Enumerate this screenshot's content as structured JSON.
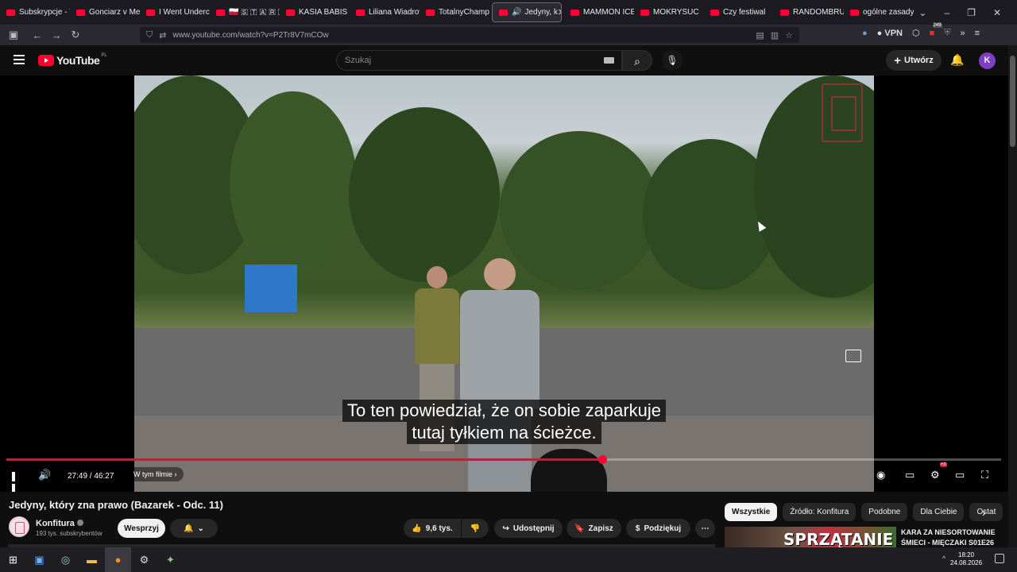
{
  "browser": {
    "tabs": [
      {
        "label": "Subskrypcje - Yo"
      },
      {
        "label": "Gonciarz v Mecir"
      },
      {
        "label": "I Went Undercov"
      },
      {
        "label": "🇵🇱 🇸 🇹 🇦 🇷 🇸"
      },
      {
        "label": "KASIA BABIS SZC"
      },
      {
        "label": "Liliana Wiadrow"
      },
      {
        "label": "TotalnyChampio"
      },
      {
        "label": "Jedyny, k",
        "active": true
      },
      {
        "label": "MAMMON ICEBE"
      },
      {
        "label": "MOKRYSUC"
      },
      {
        "label": "Czy festiwal"
      },
      {
        "label": "RANDOMBRUCE"
      },
      {
        "label": "ogólne zasady w"
      }
    ],
    "url": "www.youtube.com/watch?v=P2Tr8V7mCOw",
    "vpn_label": "VPN",
    "badge_count": "249"
  },
  "youtube": {
    "logo_text": "YouTube",
    "region": "PL",
    "search_placeholder": "Szukaj",
    "create_label": "Utwórz",
    "avatar_letter": "K"
  },
  "player": {
    "subtitle_line1": "To ten powiedział, że on sobie zaparkuje",
    "subtitle_line2": "tutaj tyłkiem na ścieżce.",
    "time": "27:49 / 46:27",
    "progress": 0.599,
    "chapters_label": "W tym filmie",
    "hd_badge": "HD"
  },
  "video": {
    "title": "Jedyny, który zna prawo (Bazarek - Odc. 11)",
    "channel": "Konfitura",
    "subscribers": "193 tys. subskrybentów",
    "support_label": "Wesprzyj",
    "likes": "9,6 tys.",
    "share_label": "Udostępnij",
    "save_label": "Zapisz",
    "thanks_label": "Podziękuj"
  },
  "related": {
    "chips": [
      "Wszystkie",
      "Źródło: Konfitura",
      "Podobne",
      "Dla Ciebie",
      "Ostat"
    ],
    "first_thumb_text": "SPRZĄTANIE",
    "first_title_l1": "KARA ZA NIESORTOWANIE",
    "first_title_l2": "ŚMIECI - MIĘCZAKI S01E26"
  },
  "taskbar": {
    "time": "18:20",
    "date": "24.08.2026"
  }
}
